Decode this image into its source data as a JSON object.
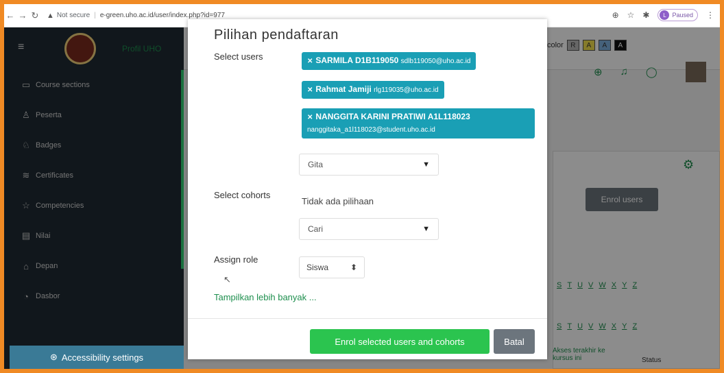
{
  "browser": {
    "security_label": "Not secure",
    "url": "e-green.uho.ac.id/user/index.php?id=977",
    "profile_status": "Paused",
    "profile_initial": "L"
  },
  "background": {
    "site_menu": "Profil UHO",
    "color_label": "color",
    "color_options": [
      "R",
      "A",
      "A",
      "A"
    ],
    "sidebar_items": [
      {
        "label": "Course sections",
        "icon": "folder-icon"
      },
      {
        "label": "Peserta",
        "icon": "users-icon"
      },
      {
        "label": "Badges",
        "icon": "badges-icon"
      },
      {
        "label": "Certificates",
        "icon": "certificate-icon"
      },
      {
        "label": "Competencies",
        "icon": "star-icon"
      },
      {
        "label": "Nilai",
        "icon": "grades-icon"
      },
      {
        "label": "Depan",
        "icon": "home-icon"
      },
      {
        "label": "Dasbor",
        "icon": "dashboard-icon"
      }
    ],
    "accessibility": "Accessibility settings",
    "enrol_users": "Enrol users",
    "letters_row": [
      "S",
      "T",
      "U",
      "V",
      "W",
      "X",
      "Y",
      "Z"
    ],
    "table_headers": {
      "last_access": "Akses terakhir ke kursus ini",
      "status": "Status"
    }
  },
  "modal": {
    "title": "Pilihan pendaftaran",
    "select_users_label": "Select users",
    "selected_users": [
      {
        "name": "SARMILA D1B119050",
        "email": "sdlb119050@uho.ac.id"
      },
      {
        "name": "Rahmat Jamiji",
        "email": "rlg119035@uho.ac.id"
      },
      {
        "name": "NANGGITA KARINI PRATIWI A1L118023",
        "email": "nanggitaka_a1l118023@student.uho.ac.id"
      }
    ],
    "user_search_value": "Gita",
    "select_cohorts_label": "Select cohorts",
    "no_selection": "Tidak ada pilihaan",
    "cohort_search_value": "Cari",
    "assign_role_label": "Assign role",
    "assign_role_value": "Siswa",
    "show_more": "Tampilkan lebih banyak ...",
    "enrol_button": "Enrol selected users and cohorts",
    "cancel_button": "Batal"
  }
}
